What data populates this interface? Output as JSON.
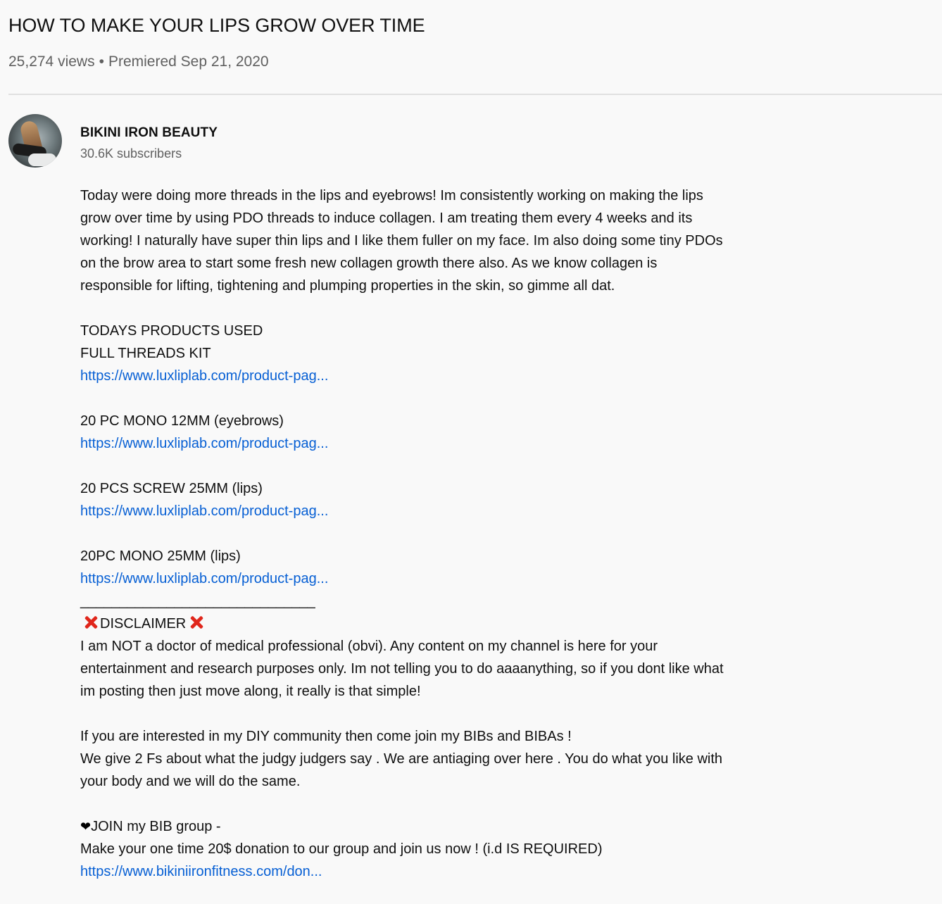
{
  "video": {
    "title": "HOW TO MAKE YOUR LIPS GROW OVER TIME",
    "views": "25,274 views",
    "separator": "•",
    "premiered": "Premiered Sep 21, 2020"
  },
  "channel": {
    "name": "BIKINI IRON BEAUTY",
    "subscribers": "30.6K subscribers"
  },
  "description": {
    "intro": [
      "Today were doing more threads in the lips and eyebrows!  Im consistently working on making the lips",
      "grow over time by using PDO threads to induce collagen. I am treating them every 4 weeks and its",
      "working!  I naturally have super thin lips and I like them fuller on my face. Im also doing some tiny PDOs",
      "on the brow area to start some fresh new collagen growth there also. As we know collagen is",
      "responsible for lifting, tightening  and plumping properties in the skin, so gimme all dat."
    ],
    "products_heading": "TODAYS PRODUCTS USED",
    "products": [
      {
        "name": "FULL THREADS KIT",
        "link": "https://www.luxliplab.com/product-pag..."
      },
      {
        "name": "20 PC MONO 12MM  (eyebrows)",
        "link": "https://www.luxliplab.com/product-pag..."
      },
      {
        "name": "20 PCS SCREW 25MM (lips)",
        "link": "https://www.luxliplab.com/product-pag..."
      },
      {
        "name": "20PC MONO 25MM (lips)",
        "link": "https://www.luxliplab.com/product-pag..."
      }
    ],
    "rule": "______________________________",
    "disclaimer_title": "DISCLAIMER",
    "disclaimer": [
      "I am NOT a doctor of medical professional (obvi). Any content on my channel is here for your",
      "entertainment and research purposes only. Im not telling you to do aaaanything, so if you dont like what",
      "im posting then just move along, it really is that simple!"
    ],
    "community": [
      "If you are interested in my DIY community then come join my BIBs and BIBAs !",
      "We give 2 Fs about what the judgy judgers say . We are antiaging over here . You do what you like with",
      "your body and we will do the same."
    ],
    "join_heart": "❤",
    "join_label": "JOIN my BIB group -",
    "donation_text": "Make your one time 20$ donation to our group and join us now ! (i.d IS REQUIRED)",
    "donation_link": "https://www.bikiniironfitness.com/don..."
  }
}
